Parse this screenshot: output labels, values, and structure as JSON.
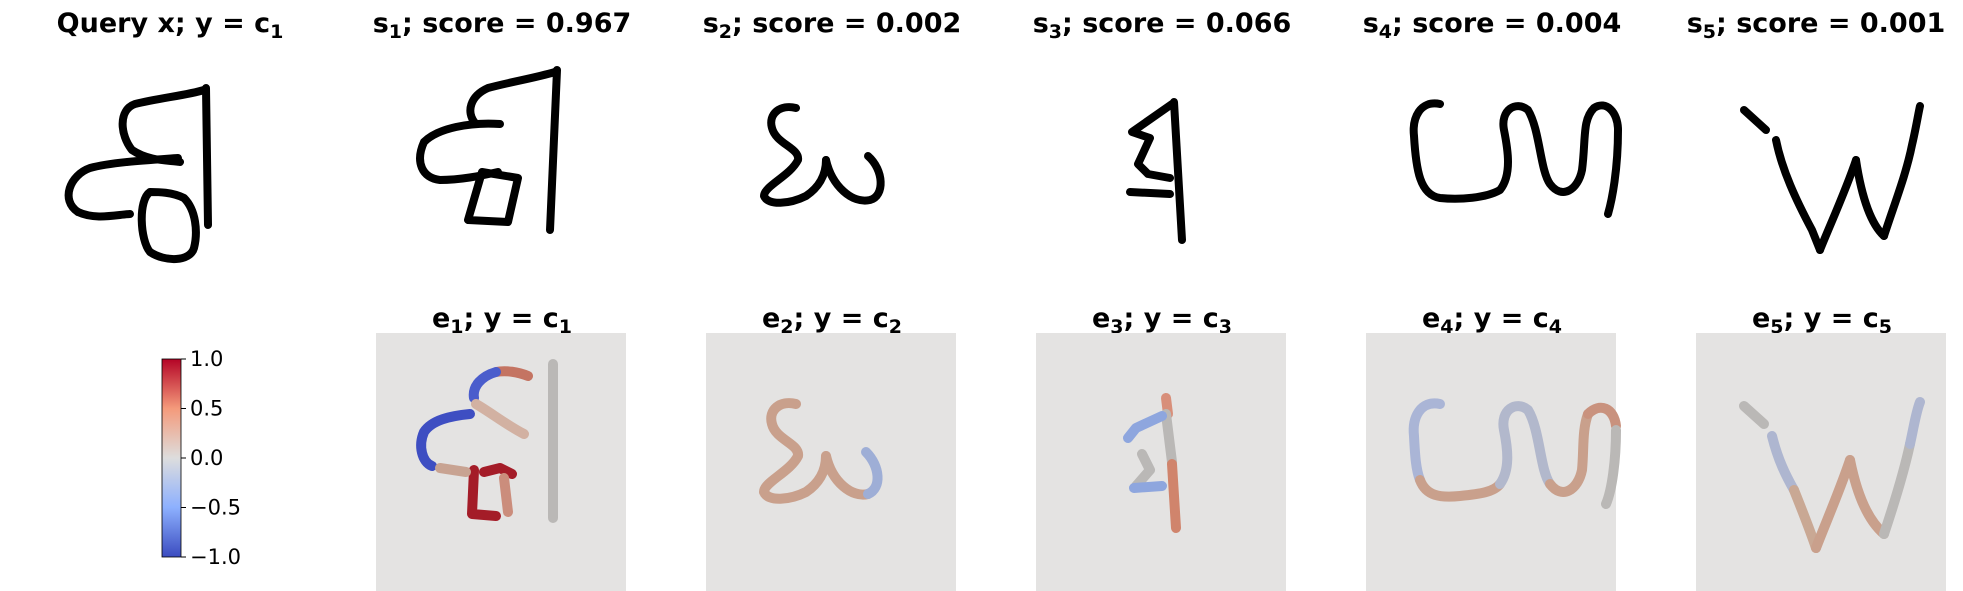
{
  "top_row": [
    {
      "label": "Query x; y = c",
      "sub": "1",
      "score": ""
    },
    {
      "label": "s",
      "sub": "1",
      "score": "; score = 0.967"
    },
    {
      "label": "s",
      "sub": "2",
      "score": "; score = 0.002"
    },
    {
      "label": "s",
      "sub": "3",
      "score": "; score = 0.066"
    },
    {
      "label": "s",
      "sub": "4",
      "score": "; score = 0.004"
    },
    {
      "label": "s",
      "sub": "5",
      "score": "; score = 0.001"
    }
  ],
  "bottom_row": [
    {
      "label": "e",
      "sub": "1",
      "rest": "; y = c",
      "sub2": "1"
    },
    {
      "label": "e",
      "sub": "2",
      "rest": "; y = c",
      "sub2": "2"
    },
    {
      "label": "e",
      "sub": "3",
      "rest": "; y = c",
      "sub2": "3"
    },
    {
      "label": "e",
      "sub": "4",
      "rest": "; y = c",
      "sub2": "4"
    },
    {
      "label": "e",
      "sub": "5",
      "rest": "; y = c",
      "sub2": "5"
    }
  ],
  "colorbar": {
    "ticks": [
      "1.0",
      "0.5",
      "0.0",
      "−0.5",
      "−1.0"
    ],
    "colormap": "coolwarm",
    "min": -1.0,
    "max": 1.0
  },
  "colors": {
    "panel_bg": "#e4e3e2",
    "stroke": "#000000",
    "neutral": "#b9b7b5",
    "red": "#a51d2a",
    "salmon": "#c97a68",
    "tan": "#c9a28e",
    "blue": "#3f4fc4",
    "lightblue": "#8fa3d6",
    "grey": "#b7b5b3"
  }
}
